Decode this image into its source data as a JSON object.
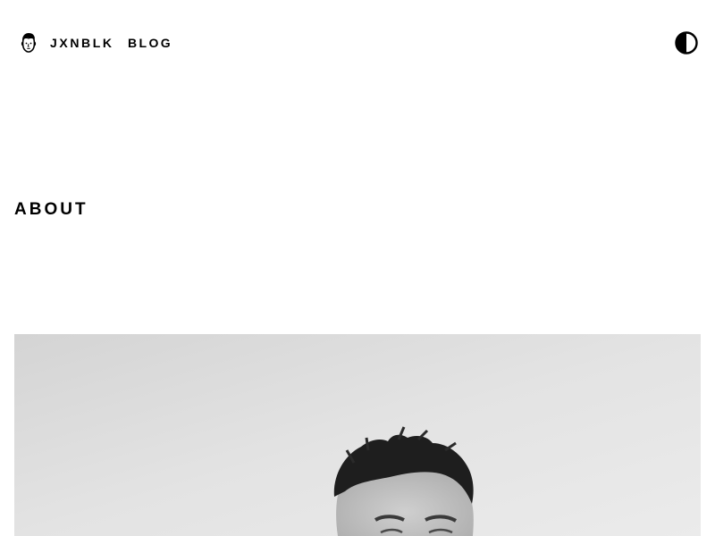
{
  "header": {
    "brand": {
      "logo_icon": "face-avatar-icon",
      "name": "JXNBLK"
    },
    "nav": {
      "items": [
        {
          "label": "BLOG"
        }
      ]
    },
    "theme_toggle": {
      "icon": "half-circle-contrast-icon"
    }
  },
  "main": {
    "title": "ABOUT",
    "hero_image": {
      "subject": "black-and-white portrait photo",
      "tone": "grayscale"
    }
  },
  "colors": {
    "background": "#ffffff",
    "text": "#000000",
    "photo_background": "#e2e2e2"
  }
}
